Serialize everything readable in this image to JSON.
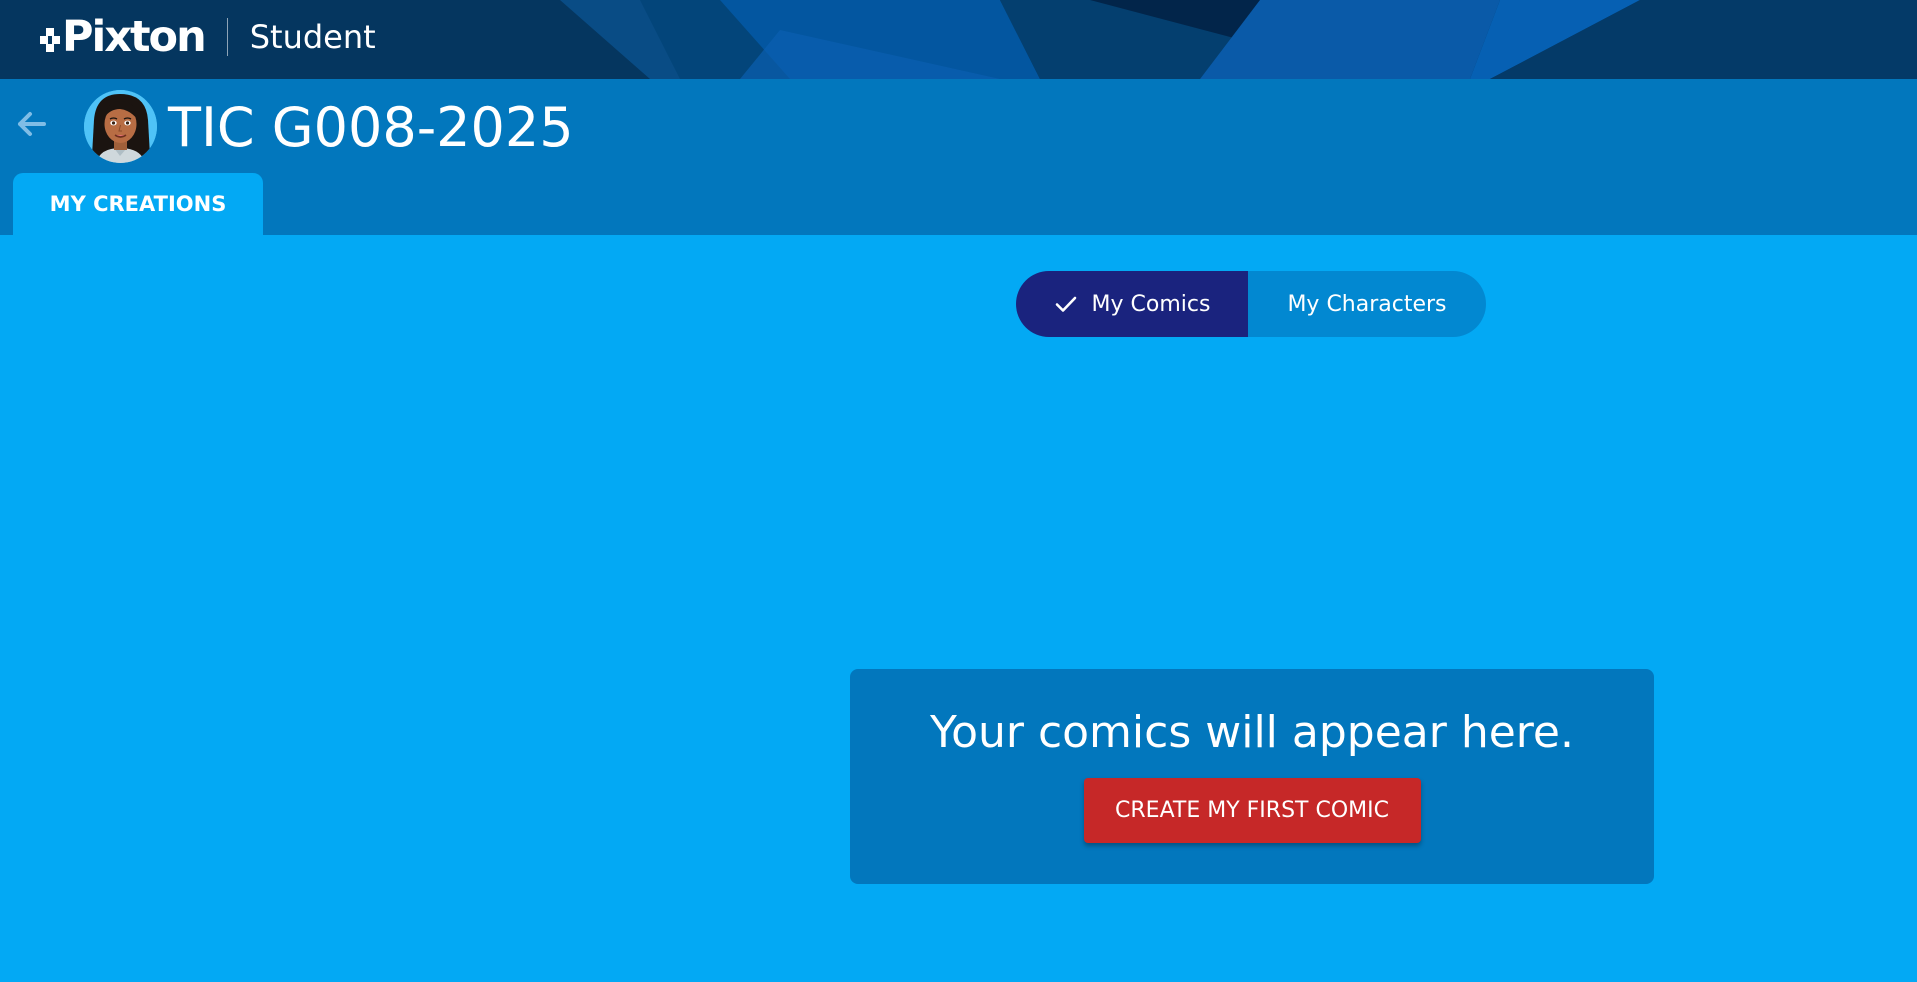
{
  "brand": {
    "logo_text": "Pixton",
    "role_label": "Student"
  },
  "header": {
    "back_icon": "arrow-left-icon",
    "class_title": "TIC G008-2025",
    "avatar": "student-avatar"
  },
  "tabs": [
    {
      "label": "MY CREATIONS",
      "active": true
    }
  ],
  "toggle": {
    "options": [
      {
        "label": "My Comics",
        "selected": true,
        "icon": "check-icon"
      },
      {
        "label": "My Characters",
        "selected": false
      }
    ]
  },
  "empty_state": {
    "message": "Your comics will appear here.",
    "button_label": "CREATE MY FIRST COMIC"
  },
  "colors": {
    "topbar": "#05365f",
    "header": "#0277bd",
    "page_background": "#03a9f4",
    "toggle_active": "#1a237e",
    "toggle_inactive": "#0288d1",
    "card": "#0277bd",
    "primary_button": "#c62828"
  }
}
